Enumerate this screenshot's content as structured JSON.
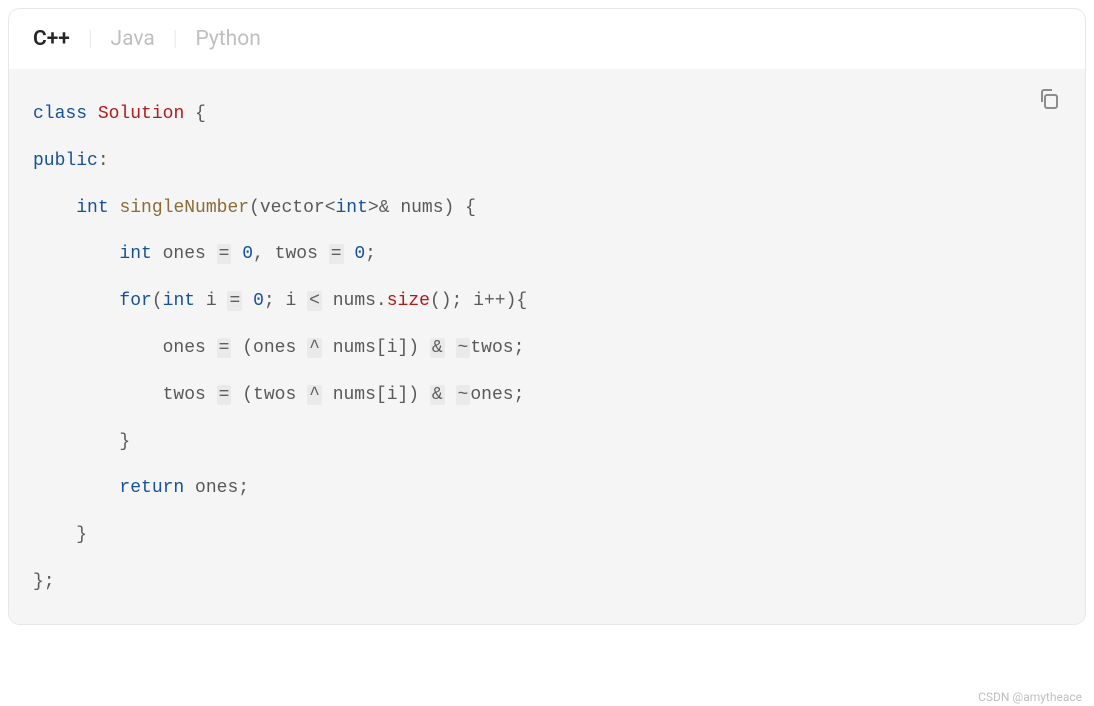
{
  "tabs": {
    "items": [
      {
        "label": "C++",
        "active": true
      },
      {
        "label": "Java",
        "active": false
      },
      {
        "label": "Python",
        "active": false
      }
    ]
  },
  "code": {
    "tokens": [
      [
        {
          "t": "class",
          "c": "kw"
        },
        {
          "t": " ",
          "c": ""
        },
        {
          "t": "Solution",
          "c": "cls"
        },
        {
          "t": " {",
          "c": "punct"
        }
      ],
      [
        {
          "t": "public",
          "c": "kw"
        },
        {
          "t": ":",
          "c": "punct"
        }
      ],
      [
        {
          "t": "    ",
          "c": ""
        },
        {
          "t": "int",
          "c": "type"
        },
        {
          "t": " ",
          "c": ""
        },
        {
          "t": "singleNumber",
          "c": "fn"
        },
        {
          "t": "(vector",
          "c": "punct"
        },
        {
          "t": "<",
          "c": "angle"
        },
        {
          "t": "int",
          "c": "type"
        },
        {
          "t": ">",
          "c": "angle"
        },
        {
          "t": "&",
          "c": "ref"
        },
        {
          "t": " nums) {",
          "c": "punct"
        }
      ],
      [
        {
          "t": "        ",
          "c": ""
        },
        {
          "t": "int",
          "c": "type"
        },
        {
          "t": " ones ",
          "c": "punct"
        },
        {
          "t": "=",
          "c": "op"
        },
        {
          "t": " ",
          "c": ""
        },
        {
          "t": "0",
          "c": "num"
        },
        {
          "t": ", twos ",
          "c": "punct"
        },
        {
          "t": "=",
          "c": "op"
        },
        {
          "t": " ",
          "c": ""
        },
        {
          "t": "0",
          "c": "num"
        },
        {
          "t": ";",
          "c": "punct"
        }
      ],
      [
        {
          "t": "        ",
          "c": ""
        },
        {
          "t": "for",
          "c": "kw"
        },
        {
          "t": "(",
          "c": "punct"
        },
        {
          "t": "int",
          "c": "type"
        },
        {
          "t": " i ",
          "c": "punct"
        },
        {
          "t": "=",
          "c": "op"
        },
        {
          "t": " ",
          "c": ""
        },
        {
          "t": "0",
          "c": "num"
        },
        {
          "t": "; i ",
          "c": "punct"
        },
        {
          "t": "<",
          "c": "op"
        },
        {
          "t": " nums.",
          "c": "punct"
        },
        {
          "t": "size",
          "c": "method"
        },
        {
          "t": "(); i",
          "c": "punct"
        },
        {
          "t": "++",
          "c": "op-nohi"
        },
        {
          "t": "){",
          "c": "punct"
        }
      ],
      [
        {
          "t": "            ones ",
          "c": "punct"
        },
        {
          "t": "=",
          "c": "op"
        },
        {
          "t": " (ones ",
          "c": "punct"
        },
        {
          "t": "^",
          "c": "op"
        },
        {
          "t": " nums[i]) ",
          "c": "punct"
        },
        {
          "t": "&",
          "c": "op"
        },
        {
          "t": " ",
          "c": ""
        },
        {
          "t": "~",
          "c": "tilde"
        },
        {
          "t": "twos;",
          "c": "punct"
        }
      ],
      [
        {
          "t": "            twos ",
          "c": "punct"
        },
        {
          "t": "=",
          "c": "op"
        },
        {
          "t": " (twos ",
          "c": "punct"
        },
        {
          "t": "^",
          "c": "op"
        },
        {
          "t": " nums[i]) ",
          "c": "punct"
        },
        {
          "t": "&",
          "c": "op"
        },
        {
          "t": " ",
          "c": ""
        },
        {
          "t": "~",
          "c": "tilde"
        },
        {
          "t": "ones;",
          "c": "punct"
        }
      ],
      [
        {
          "t": "        }",
          "c": "punct"
        }
      ],
      [
        {
          "t": "        ",
          "c": ""
        },
        {
          "t": "return",
          "c": "kw"
        },
        {
          "t": " ones;",
          "c": "punct"
        }
      ],
      [
        {
          "t": "    }",
          "c": "punct"
        }
      ],
      [
        {
          "t": "};",
          "c": "punct"
        }
      ]
    ]
  },
  "watermark": "CSDN @amytheace"
}
